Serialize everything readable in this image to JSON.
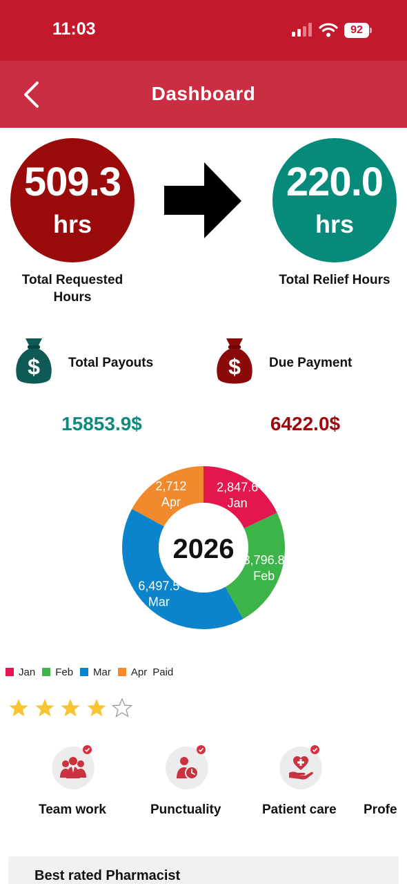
{
  "status_bar": {
    "time": "11:03",
    "battery": "92"
  },
  "nav": {
    "title": "Dashboard",
    "back_icon": "chevron-left-icon"
  },
  "hours": {
    "requested": {
      "value": "509.3",
      "unit": "hrs",
      "label": "Total Requested Hours",
      "color": "#9b0a0a"
    },
    "relief": {
      "value": "220.0",
      "unit": "hrs",
      "label": "Total Relief Hours",
      "color": "#068a7a"
    },
    "arrow_icon": "arrow-right-icon"
  },
  "payments": {
    "payouts": {
      "label": "Total Payouts",
      "value": "15853.9$",
      "icon": "money-bag-icon",
      "color": "#108a7c"
    },
    "due": {
      "label": "Due Payment",
      "value": "6422.0$",
      "icon": "money-bag-icon",
      "color": "#9b0a0a"
    }
  },
  "chart_data": {
    "type": "pie",
    "center_label": "2026",
    "categories": [
      "Jan",
      "Feb",
      "Mar",
      "Apr"
    ],
    "values": [
      2847.6,
      3796.8,
      6497.5,
      2712
    ],
    "value_labels": [
      "2,847.6",
      "3,796.8",
      "6,497.5",
      "2,712"
    ],
    "colors": [
      "#e3174e",
      "#3db44a",
      "#0b84cc",
      "#f08a2c"
    ],
    "legend": {
      "entries": [
        "Jan",
        "Feb",
        "Mar",
        "Apr"
      ],
      "suffix": "Paid",
      "placement": "bottom-left"
    }
  },
  "rating": {
    "value": 4,
    "max": 5,
    "color": "#f7c531"
  },
  "skills": [
    {
      "label": "Team work",
      "icon": "team-icon"
    },
    {
      "label": "Punctuality",
      "icon": "punctuality-clock-icon"
    },
    {
      "label": "Patient care",
      "icon": "patient-care-icon"
    },
    {
      "label": "Profe"
    }
  ],
  "bottom_card": {
    "title": "Best rated Pharmacist"
  }
}
